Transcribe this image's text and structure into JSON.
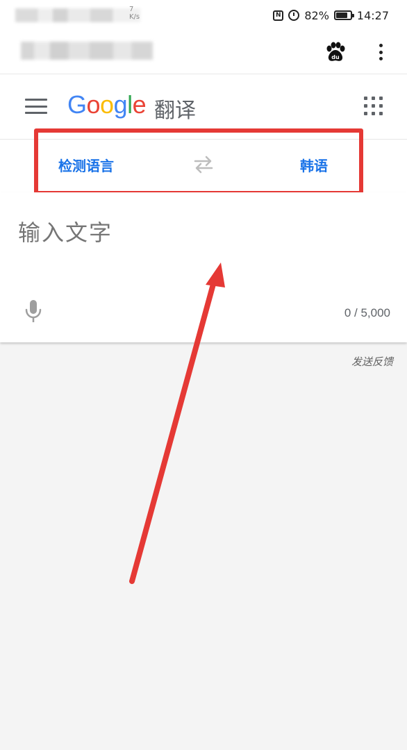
{
  "status_bar": {
    "battery": "82%",
    "time": "14:27",
    "speed_top": "7",
    "speed_unit": "K/s",
    "nfc_icon": "nfc-icon",
    "alarm_icon": "alarm-icon",
    "battery_icon": "battery-icon"
  },
  "browser": {
    "baidu_icon": "baidu-paw-icon",
    "baidu_text": "du",
    "menu_icon": "more-vert-icon"
  },
  "app": {
    "logo_text": "Google",
    "title": "翻译",
    "menu_icon": "hamburger-menu-icon",
    "apps_icon": "apps-grid-icon"
  },
  "languages": {
    "source": "检测语言",
    "target": "韩语",
    "swap_icon": "swap-arrows-icon"
  },
  "input": {
    "placeholder": "输入文字",
    "char_count": "0 / 5,000",
    "mic_icon": "microphone-icon"
  },
  "feedback": "发送反馈",
  "colors": {
    "accent": "#1a73e8",
    "annotation": "#e53935",
    "google_blue": "#4285f4",
    "google_red": "#ea4335",
    "google_yellow": "#fbbc05",
    "google_green": "#34a853"
  }
}
